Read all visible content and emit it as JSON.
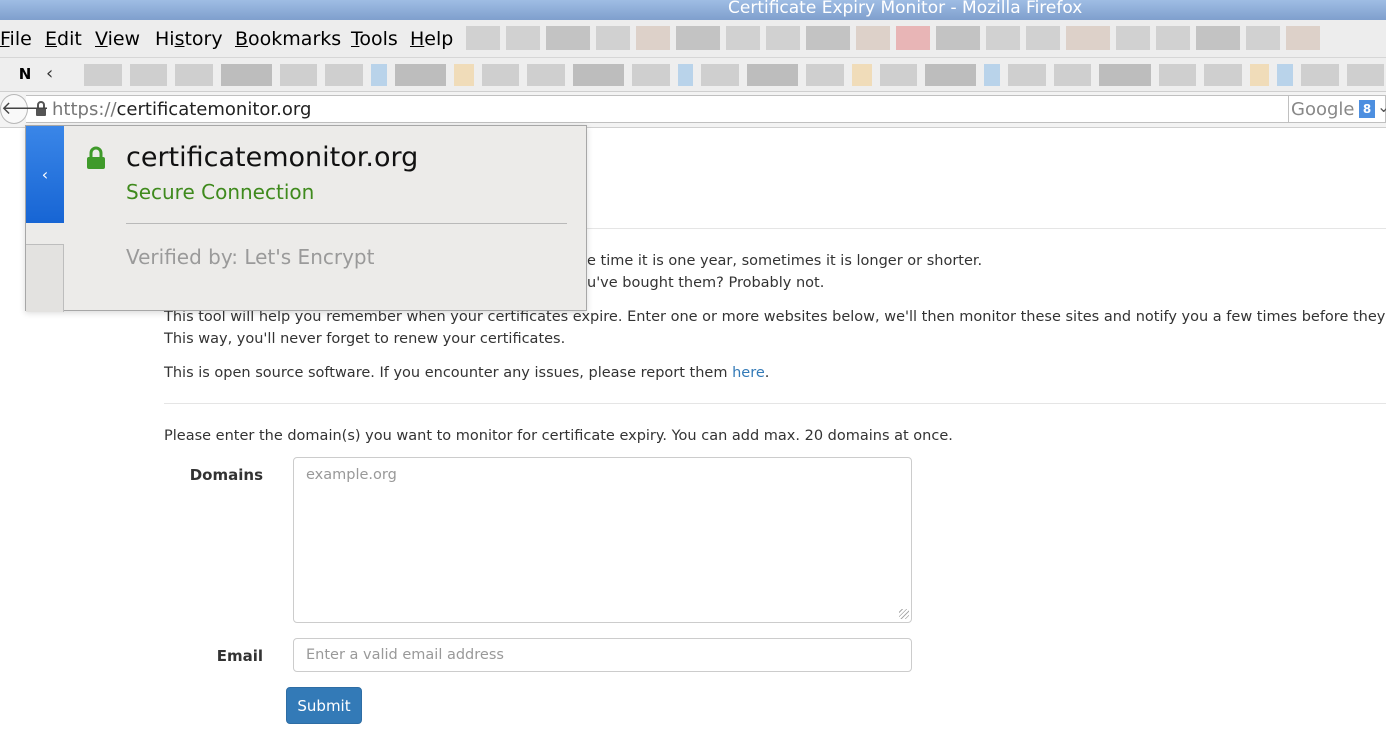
{
  "window": {
    "title": "Certificate Expiry Monitor - Mozilla Firefox"
  },
  "menubar": {
    "items": [
      {
        "label": "File",
        "underline": "F",
        "rest": "ile"
      },
      {
        "label": "Edit",
        "underline": "E",
        "rest": "dit"
      },
      {
        "label": "View",
        "underline": "V",
        "rest": "iew"
      },
      {
        "label": "History",
        "prefix": "Hi",
        "underline": "s",
        "rest": "tory"
      },
      {
        "label": "Bookmarks",
        "underline": "B",
        "rest": "ookmarks"
      },
      {
        "label": "Tools",
        "underline": "T",
        "rest": "ools"
      },
      {
        "label": "Help",
        "underline": "H",
        "rest": "elp"
      }
    ]
  },
  "bookmarks": {
    "first_icon": "N",
    "nav_icon": "chevron-left-icon"
  },
  "urlbar": {
    "protocol": "https://",
    "host": "certificatemonitor.org",
    "lock_icon": "lock-icon",
    "search_engine": "Google",
    "search_badge": "8"
  },
  "popup": {
    "host": "certificatemonitor.org",
    "status": "Secure Connection",
    "verified_by": "Verified by: Let's Encrypt",
    "back_icon": "chevron-left-icon",
    "status_color": "#3f8a1d",
    "accent_color": "#1765d4"
  },
  "page": {
    "intro_line1": "e time it is one year, sometimes it is longer or shorter.",
    "intro_line2": "u've bought them? Probably not.",
    "tool_line1": "This tool will help you remember when your certificates expire. Enter one or more websites below, we'll then monitor these sites and notify you a few times before they expire.",
    "tool_line2": "This way, you'll never forget to renew your certificates.",
    "open_source_prefix": "This is open source software. If you encounter any issues, please report them ",
    "open_source_link": "here",
    "open_source_suffix": ".",
    "form_intro": "Please enter the domain(s) you want to monitor for certificate expiry. You can add max. 20 domains at once.",
    "domains_label": "Domains",
    "domains_placeholder": "example.org",
    "email_label": "Email",
    "email_placeholder": "Enter a valid email address",
    "submit_label": "Submit",
    "link_color": "#337ab7",
    "button_color": "#337ab7"
  }
}
